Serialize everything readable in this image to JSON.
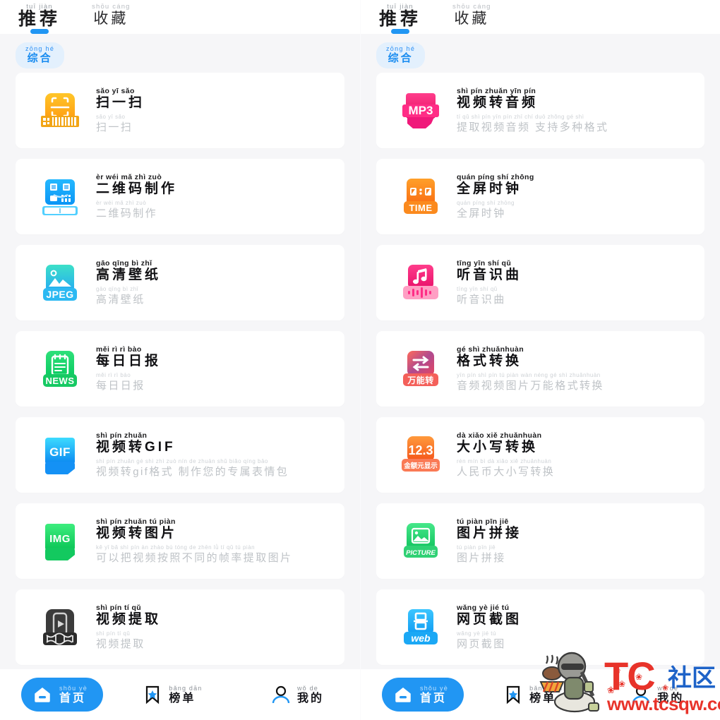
{
  "colors": {
    "accent": "#2196f3",
    "chip_bg": "#e3f0fd",
    "chip_text": "#1a8cf0",
    "page_bg": "#f6f6f8",
    "card_bg": "#ffffff",
    "title": "#101013",
    "subtitle": "#bfc3c7",
    "watermark_red": "#e8332a",
    "watermark_blue": "#1e63c8"
  },
  "header": {
    "tabs": [
      {
        "pinyin": "tuī jiàn",
        "label": "推荐",
        "active": true
      },
      {
        "pinyin": "shōu cáng",
        "label": "收藏",
        "active": false
      }
    ]
  },
  "filter_chip": {
    "pinyin": "zōng hé",
    "label": "综合"
  },
  "panels": [
    {
      "id": "left-panel",
      "items": [
        {
          "icon": "scan-code-icon",
          "icon_label": "",
          "title_pinyin": "sǎo  yī  sǎo",
          "title": "扫一扫",
          "sub_pinyin": "sǎo  yī  sǎo",
          "sub": "扫一扫"
        },
        {
          "icon": "qrcode-maker-icon",
          "icon_label": "",
          "title_pinyin": "èr  wéi  mǎ  zhì  zuò",
          "title": "二维码制作",
          "sub_pinyin": "èr  wéi  mǎ  zhì  zuò",
          "sub": "二维码制作"
        },
        {
          "icon": "jpeg-wallpaper-icon",
          "icon_label": "JPEG",
          "title_pinyin": "gāo qīng  bì  zhǐ",
          "title": "高清壁纸",
          "sub_pinyin": "gāo qīng  bì  zhǐ",
          "sub": "高清壁纸"
        },
        {
          "icon": "news-daily-icon",
          "icon_label": "NEWS",
          "title_pinyin": "měi  rì  rì  bào",
          "title": "每日日报",
          "sub_pinyin": "měi  rì  rì  bào",
          "sub": "每日日报"
        },
        {
          "icon": "gif-convert-icon",
          "icon_label": "GIF",
          "title_pinyin": "shì  pín zhuǎn",
          "title": "视频转GIF",
          "sub_pinyin": "shì pín zhuǎn   gé  shì   zhì  zuò nín  de  zhuān shǔ biǎo qíng bāo",
          "sub": "视频转gif格式 制作您的专属表情包"
        },
        {
          "icon": "img-convert-icon",
          "icon_label": "IMG",
          "title_pinyin": "shì  pín zhuǎn  tú  piàn",
          "title": "视频转图片",
          "sub_pinyin": "kě  yǐ  bǎ  shì  pín  àn zhào  bù tóng  de zhēn lǜ   tí   qǔ   tú  piàn",
          "sub": "可以把视频按照不同的帧率提取图片"
        },
        {
          "icon": "video-extract-icon",
          "icon_label": "",
          "title_pinyin": "shì  pín  tí  qǔ",
          "title": "视频提取",
          "sub_pinyin": "shì  pín  tí  qǔ",
          "sub": "视频提取"
        }
      ],
      "bottom_nav": [
        {
          "icon": "home-icon",
          "pinyin": "shǒu yè",
          "label": "首页",
          "active": true
        },
        {
          "icon": "bookmark-icon",
          "pinyin": "bǎng dān",
          "label": "榜单",
          "active": false
        },
        {
          "icon": "user-icon",
          "pinyin": "wǒ  de",
          "label": "我的",
          "active": false
        }
      ],
      "watermark": null
    },
    {
      "id": "right-panel",
      "items": [
        {
          "icon": "mp3-convert-icon",
          "icon_label": "MP3",
          "title_pinyin": "shì  pín zhuǎn yīn  pín",
          "title": "视频转音频",
          "sub_pinyin": "tí   qǔ  shì  pín  yīn  pín   zhī  chí  duō zhǒng  gé  shì",
          "sub": "提取视频音频 支持多种格式"
        },
        {
          "icon": "fullscreen-clock-icon",
          "icon_label": "TIME",
          "title_pinyin": "quán píng  shí zhōng",
          "title": "全屏时钟",
          "sub_pinyin": "quán píng  shí zhōng",
          "sub": "全屏时钟"
        },
        {
          "icon": "music-recognize-icon",
          "icon_label": "",
          "title_pinyin": "tīng  yīn  shí  qǔ",
          "title": "听音识曲",
          "sub_pinyin": "tīng  yīn  shí  qǔ",
          "sub": "听音识曲"
        },
        {
          "icon": "format-convert-icon",
          "icon_label": "万能转",
          "title_pinyin": "gé   shì zhuǎnhuàn",
          "title": "格式转换",
          "sub_pinyin": "yīn  pín  shì  pín  tú  piàn wàn néng  gé  shì zhuǎnhuàn",
          "sub": "音频视频图片万能格式转换"
        },
        {
          "icon": "case-convert-icon",
          "icon_label": "12.3",
          "icon_badge": "金额元显示",
          "title_pinyin": "dà  xiǎo  xiě zhuǎnhuàn",
          "title": "大小写转换",
          "sub_pinyin": "rén  mín  bì   dà  xiǎo  xiě zhuǎnhuàn",
          "sub": "人民币大小写转换"
        },
        {
          "icon": "picture-stitch-icon",
          "icon_label": "PICTURE",
          "title_pinyin": "tú  piàn pīn  jiē",
          "title": "图片拼接",
          "sub_pinyin": "tú  piàn pīn  jiē",
          "sub": "图片拼接"
        },
        {
          "icon": "web-screenshot-icon",
          "icon_label": "web",
          "title_pinyin": "wǎng yè  jié  tú",
          "title": "网页截图",
          "sub_pinyin": "wǎng yè  jié  tú",
          "sub": "网页截图"
        }
      ],
      "bottom_nav": [
        {
          "icon": "home-icon",
          "pinyin": "shǒu yè",
          "label": "首页",
          "active": true
        },
        {
          "icon": "bookmark-icon",
          "pinyin": "bǎng dān",
          "label": "榜单",
          "active": false
        },
        {
          "icon": "user-icon",
          "pinyin": "wǒ  de",
          "label": "我的",
          "active": false
        }
      ],
      "watermark": {
        "brand": "TC",
        "brand_cn": "社区",
        "url": "www.tcsqw.com"
      }
    }
  ]
}
